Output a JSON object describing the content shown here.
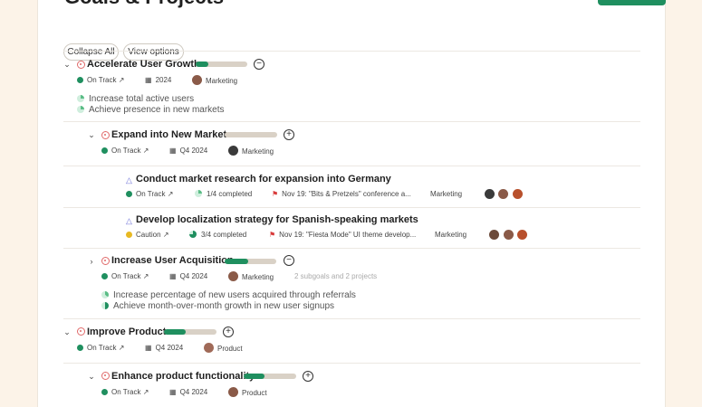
{
  "header": {
    "title": "Goals & Projects"
  },
  "toolbar": {
    "collapse_all": "Collapse All",
    "view_options": "View options"
  },
  "colors": {
    "green": "#1f8f5f",
    "track": "#d9d1c6",
    "caution": "#e8b922",
    "goal": "#e06a6a",
    "project": "#6f73d8",
    "flag": "#d83a3a"
  },
  "goals": [
    {
      "title": "Accelerate User Growth",
      "progress": 0.25,
      "status": "On Track",
      "period": "2024",
      "team": "Marketing",
      "key_results": [
        "Increase total active users",
        "Achieve presence in new markets"
      ]
    },
    {
      "title": "Expand into New Markets",
      "progress": 0.0,
      "status": "On Track",
      "period": "Q4 2024",
      "team": "Marketing"
    },
    {
      "title": "Increase User Acquisition",
      "progress": 0.45,
      "status": "On Track",
      "period": "Q4 2024",
      "team": "Marketing",
      "summary": "2 subgoals and 2 projects",
      "key_results": [
        "Increase percentage of new users acquired through referrals",
        "Achieve month-over-month growth in new user signups"
      ]
    },
    {
      "title": "Improve Product",
      "progress": 0.42,
      "status": "On Track",
      "period": "Q4 2024",
      "team": "Product"
    },
    {
      "title": "Enhance product functionality",
      "progress": 0.4,
      "status": "On Track",
      "period": "Q4 2024",
      "team": "Product"
    }
  ],
  "projects": [
    {
      "title": "Conduct market research for expansion into Germany",
      "status": "On Track",
      "completed": "1/4 completed",
      "milestone": "Nov 19: \"Bits & Pretzels\" conference a...",
      "team": "Marketing"
    },
    {
      "title": "Develop localization strategy for Spanish-speaking markets",
      "status": "Caution",
      "completed": "3/4 completed",
      "milestone": "Nov 19: \"Fiesta Mode\" UI theme develop...",
      "team": "Marketing"
    }
  ],
  "icons": {
    "expanded": "chevron-down-icon",
    "collapsed": "chevron-right-icon",
    "goal": "target-icon",
    "project": "project-icon",
    "external": "arrow-up-right-icon",
    "calendar": "calendar-icon",
    "flag": "flag-icon",
    "collapse": "minus-circle-icon",
    "expand": "plus-circle-icon"
  }
}
